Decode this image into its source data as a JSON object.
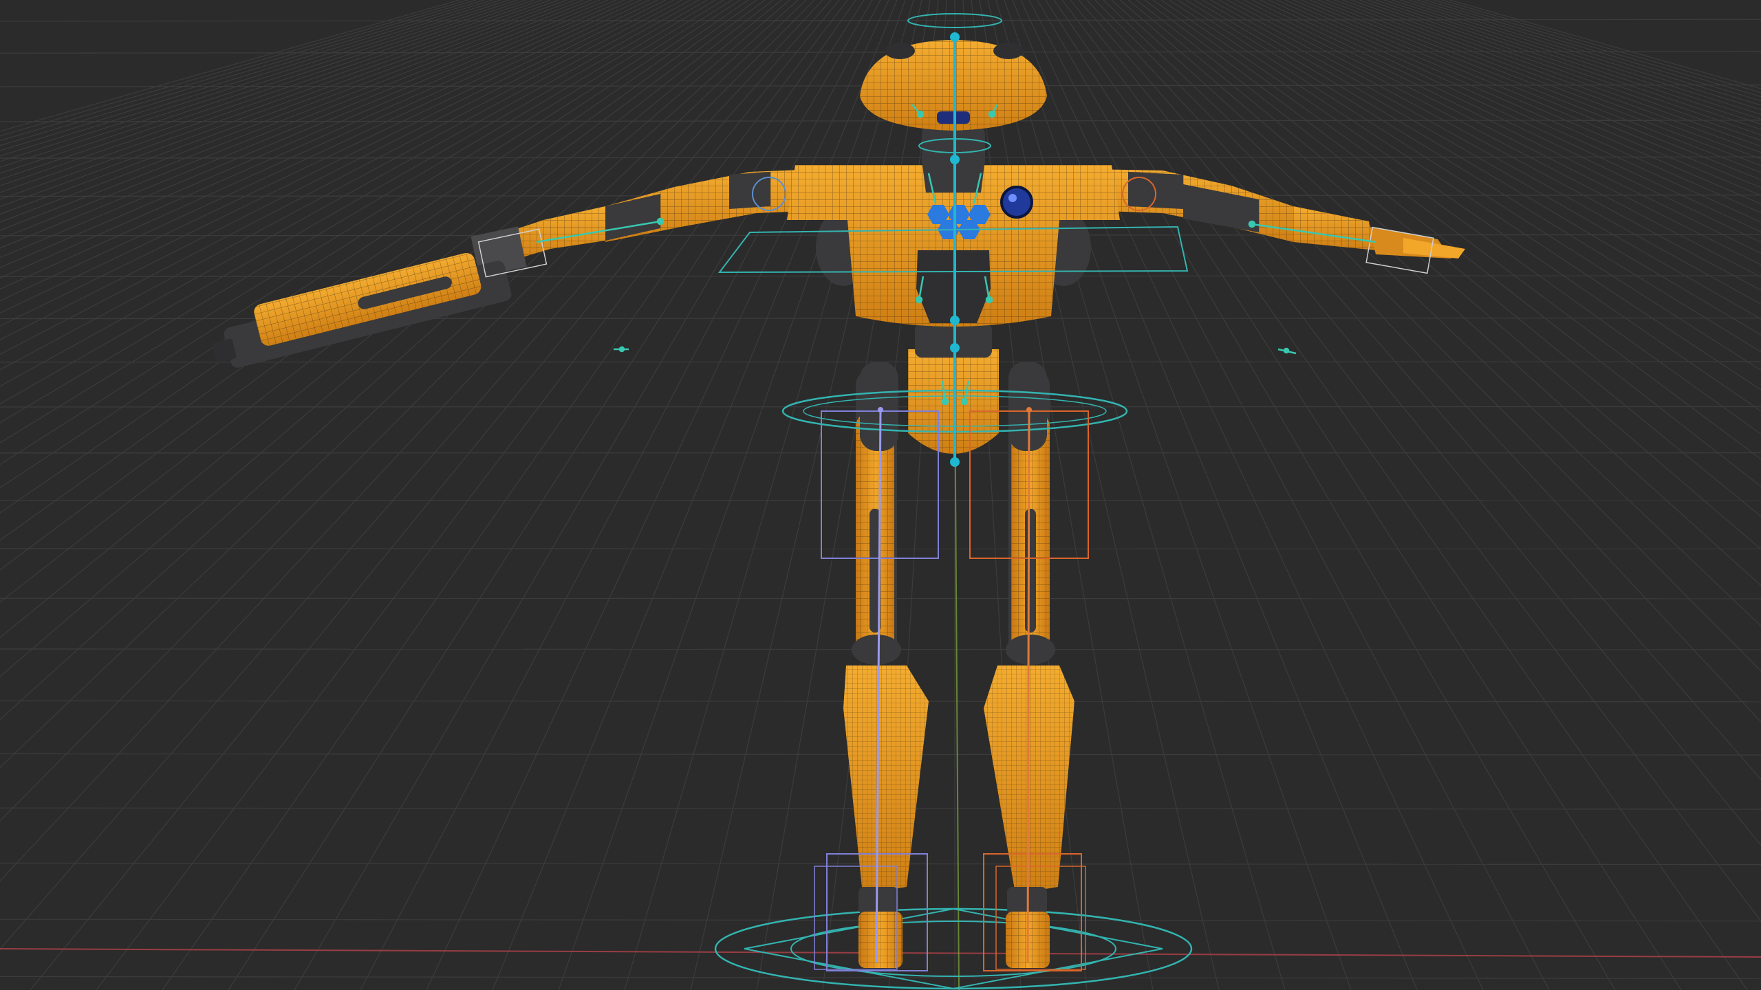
{
  "viewport": {
    "background_color": "#2b2b2b",
    "grid_color": "#3c3c3c",
    "x_axis_color": "#b4424a",
    "z_axis_color": "#7aa33a",
    "mesh_fill_color": "#e89a22",
    "mesh_wire_color": "#3a2a10",
    "dark_part_color": "#3a3a3c",
    "circle_control_color": "#33b4b0",
    "left_box_control_color": "#8080d8",
    "right_box_control_color": "#d9662a",
    "bone_color": "#39c8b0",
    "spine_bone_color": "#1fb8d0",
    "chest_emblem_color": "#2a7ae0"
  },
  "scene": {
    "object_type": "rigged-robot-mesh",
    "pose": "t-pose",
    "weapon_arm": "left",
    "overlay": "wireframe",
    "controls_visible": true,
    "axes_visible": [
      "x",
      "z"
    ]
  }
}
